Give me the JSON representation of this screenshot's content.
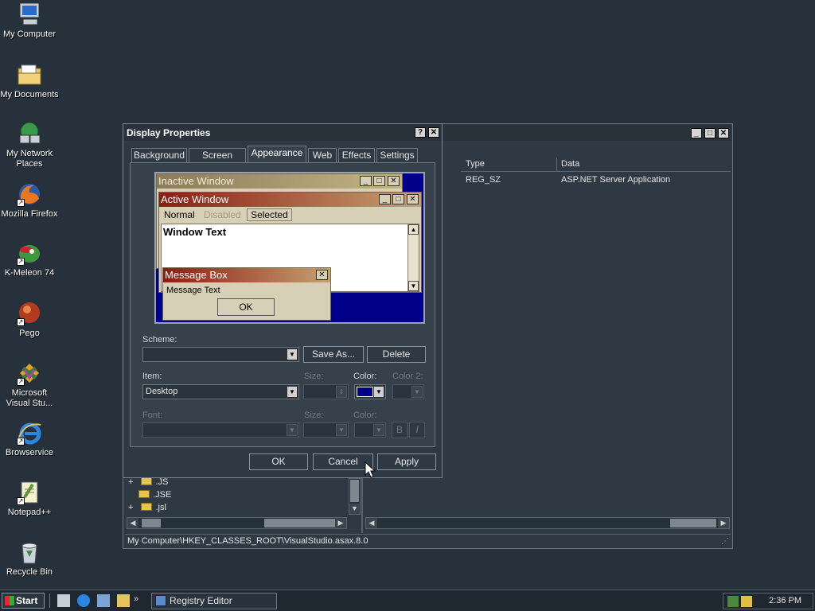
{
  "desktop": {
    "icons": [
      {
        "label": "My Computer",
        "icon": "my-computer-icon"
      },
      {
        "label": "My Documents",
        "icon": "my-documents-icon"
      },
      {
        "label": "My Network Places",
        "icon": "network-places-icon"
      },
      {
        "label": "Mozilla Firefox",
        "icon": "firefox-icon"
      },
      {
        "label": "K-Meleon 74",
        "icon": "k-meleon-icon"
      },
      {
        "label": "Pego",
        "icon": "pego-icon"
      },
      {
        "label": "Microsoft Visual Stu...",
        "icon": "visual-studio-icon"
      },
      {
        "label": "Browservice",
        "icon": "internet-explorer-icon"
      },
      {
        "label": "Notepad++",
        "icon": "notepad-plus-icon"
      },
      {
        "label": "Recycle Bin",
        "icon": "recycle-bin-icon"
      }
    ]
  },
  "regedit": {
    "columns": {
      "type": "Type",
      "data": "Data"
    },
    "row": {
      "type": "REG_SZ",
      "data": "ASP.NET Server Application"
    },
    "tree": [
      ".JS",
      ".JSE",
      ".jsl"
    ],
    "status": "My Computer\\HKEY_CLASSES_ROOT\\VisualStudio.asax.8.0"
  },
  "dialog": {
    "title": "Display Properties",
    "help_label": "?",
    "close_label": "✕",
    "tabs": [
      "Background",
      "Screen Saver",
      "Appearance",
      "Web",
      "Effects",
      "Settings"
    ],
    "active_tab": "Appearance",
    "preview": {
      "inactive_window": "Inactive Window",
      "active_window": "Active Window",
      "menu": {
        "normal": "Normal",
        "disabled": "Disabled",
        "selected": "Selected"
      },
      "window_text": "Window Text",
      "message_box": "Message Box",
      "message_text": "Message Text",
      "ok": "OK"
    },
    "scheme_label": "Scheme:",
    "scheme_value": "",
    "save_as": "Save As...",
    "delete": "Delete",
    "item_label": "Item:",
    "item_value": "Desktop",
    "size_label": "Size:",
    "color_label": "Color:",
    "color2_label": "Color 2:",
    "font_label": "Font:",
    "font_size_label": "Size:",
    "font_color_label": "Color:",
    "bold": "B",
    "italic": "I",
    "ok": "OK",
    "cancel": "Cancel",
    "apply": "Apply",
    "desktop_color": "#00008a"
  },
  "taskbar": {
    "start": "Start",
    "task": "Registry Editor",
    "clock": "2:36 PM"
  }
}
